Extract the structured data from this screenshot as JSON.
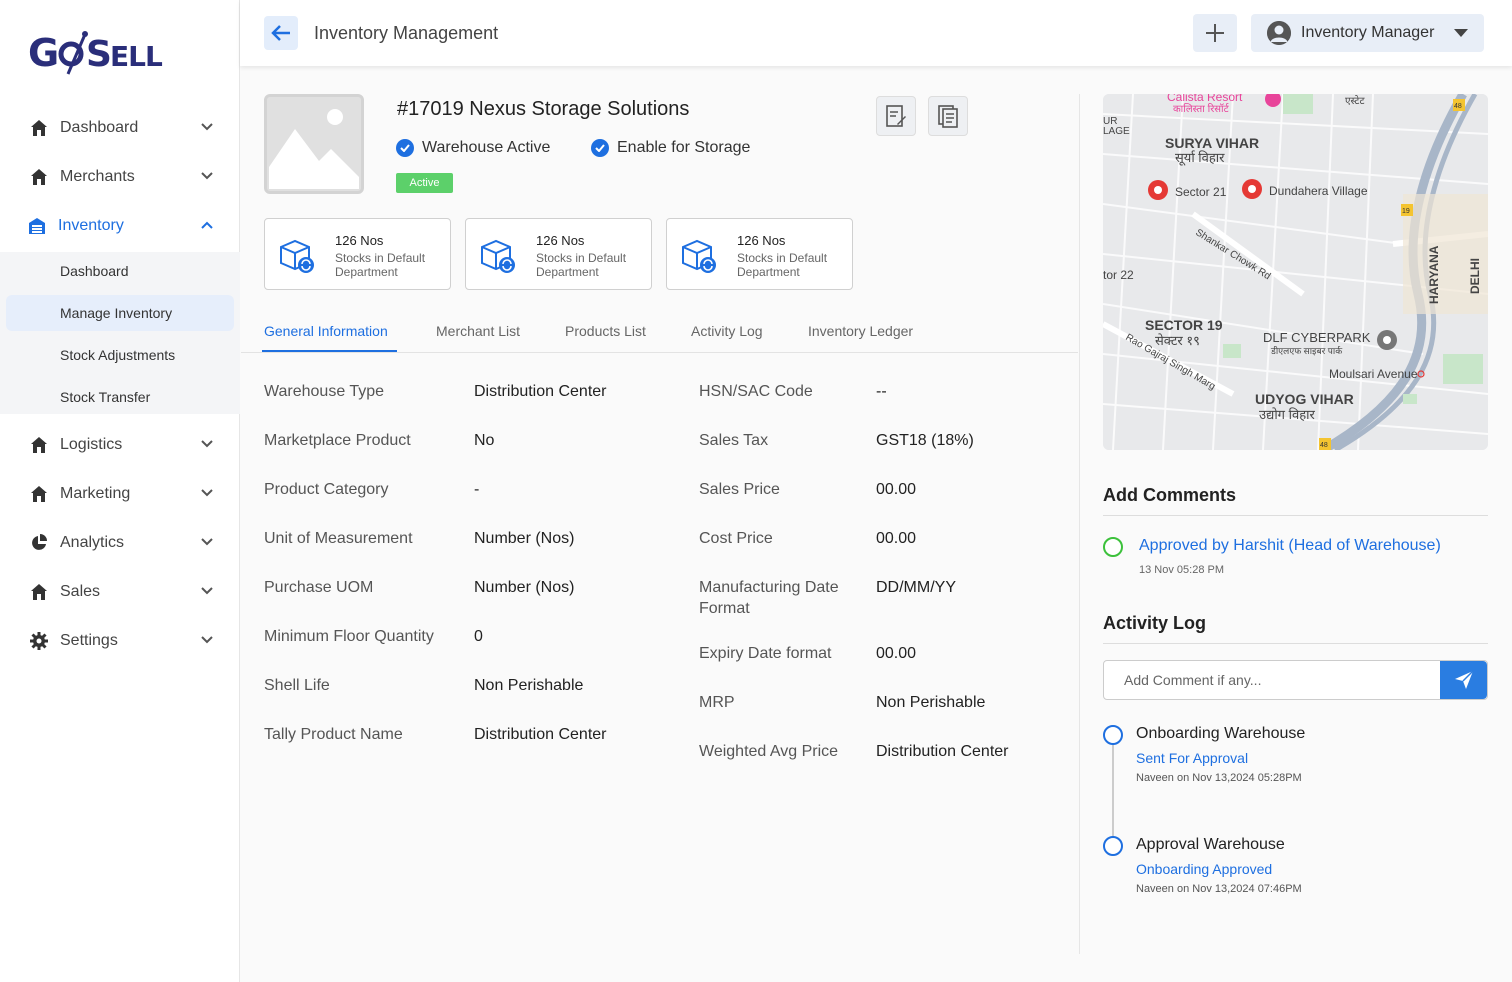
{
  "brand": {
    "logo_text": "GoSell"
  },
  "sidebar": {
    "items": [
      {
        "label": "Dashboard",
        "icon": "home-icon"
      },
      {
        "label": "Merchants",
        "icon": "home-icon"
      },
      {
        "label": "Inventory",
        "icon": "inventory-icon"
      },
      {
        "label": "Logistics",
        "icon": "home-icon"
      },
      {
        "label": "Marketing",
        "icon": "home-icon"
      },
      {
        "label": "Analytics",
        "icon": "pie-chart-icon"
      },
      {
        "label": "Sales",
        "icon": "home-icon"
      },
      {
        "label": "Settings",
        "icon": "gear-icon"
      }
    ],
    "subitems": [
      "Dashboard",
      "Manage Inventory",
      "Stock Adjustments",
      "Stock Transfer"
    ]
  },
  "header": {
    "title": "Inventory Management",
    "user_label": "Inventory Manager"
  },
  "product": {
    "title": "#17019 Nexus Storage Solutions",
    "check1": "Warehouse Active",
    "check2": "Enable for Storage",
    "status": "Active"
  },
  "stats": [
    {
      "value": "126 Nos",
      "label": "Stocks in Default Department"
    },
    {
      "value": "126 Nos",
      "label": "Stocks in Default Department"
    },
    {
      "value": "126 Nos",
      "label": "Stocks in Default Department"
    }
  ],
  "tabs": [
    "General Information",
    "Merchant List",
    "Products List",
    "Activity Log",
    "Inventory Ledger"
  ],
  "fields_left": [
    {
      "label": "Warehouse Type",
      "value": "Distribution Center"
    },
    {
      "label": "Marketplace Product",
      "value": "No"
    },
    {
      "label": "Product Category",
      "value": "-"
    },
    {
      "label": "Unit of Measurement",
      "value": "Number (Nos)"
    },
    {
      "label": "Purchase UOM",
      "value": "Number (Nos)"
    },
    {
      "label": "Minimum Floor Quantity",
      "value": "0"
    },
    {
      "label": "Shell Life",
      "value": "Non Perishable"
    },
    {
      "label": "Tally Product Name",
      "value": "Distribution Center"
    }
  ],
  "fields_right": [
    {
      "label": "HSN/SAC Code",
      "value": "--"
    },
    {
      "label": "Sales Tax",
      "value": "GST18 (18%)"
    },
    {
      "label": "Sales Price",
      "value": "00.00"
    },
    {
      "label": "Cost Price",
      "value": "00.00"
    },
    {
      "label": "Manufacturing Date Format",
      "value": "DD/MM/YY"
    },
    {
      "label": "Expiry Date format",
      "value": "00.00"
    },
    {
      "label": "MRP",
      "value": "Non Perishable"
    },
    {
      "label": "Weighted Avg Price",
      "value": "Distribution Center"
    }
  ],
  "map": {
    "labels": [
      "Calista Resort",
      "कालिस्ता रिसॉर्ट",
      "SURYA VIHAR",
      "सूर्या विहार",
      "Sector 21",
      "Dundahera Village",
      "Shankar Chowk Rd",
      "tor 22",
      "SECTOR 19",
      "सेक्टर १९",
      "DLF CYBERPARK",
      "डीएलएफ साइबर पार्क",
      "Rao Gajraj Singh Marg",
      "Moulsari Avenue",
      "UDYOG VIHAR",
      "उद्योग विहार",
      "HARYANA",
      "DELHI",
      "एस्टेट",
      "UR",
      "LAGE",
      "48",
      "19"
    ]
  },
  "comments": {
    "title": "Add Comments",
    "item_text": "Approved by Harshit (Head of Warehouse)",
    "item_time": "13 Nov 05:28 PM"
  },
  "activity": {
    "title": "Activity Log",
    "placeholder": "Add Comment if any...",
    "items": [
      {
        "title": "Onboarding Warehouse",
        "status": "Sent For Approval",
        "meta": "Naveen on Nov 13,2024 05:28PM"
      },
      {
        "title": "Approval Warehouse",
        "status": "Onboarding Approved",
        "meta": "Naveen on Nov 13,2024 07:46PM"
      }
    ]
  },
  "colors": {
    "accent": "#1e6fe0",
    "brand": "#2a2e7a",
    "active_badge": "#5cd06a",
    "comment_ring": "#3cc13b"
  }
}
